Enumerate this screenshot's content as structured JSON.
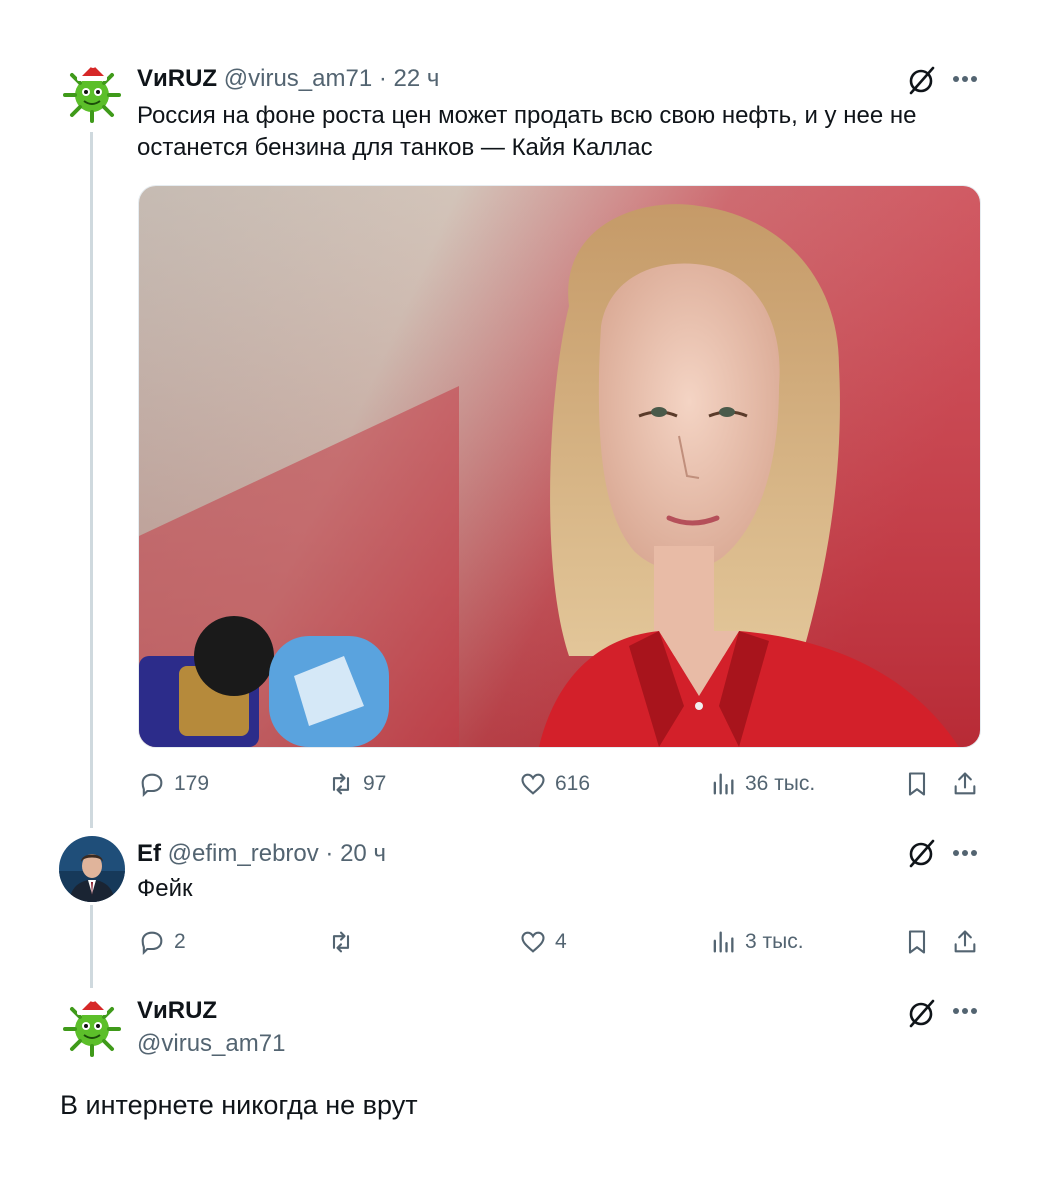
{
  "tweet1": {
    "name": "VиRUZ",
    "handle": "@virus_am71",
    "time": "· 22 ч",
    "text_line1": "Россия на фоне роста цен может продать всю свою нефть, и у нее не",
    "text_line2": "останется бензина для танков — Кайя Каллас",
    "replies": "179",
    "reposts": "97",
    "likes": "616",
    "views": "36 тыс."
  },
  "tweet2": {
    "name": "Ef",
    "handle": "@efim_rebrov",
    "time": "· 20 ч",
    "text": "Фейк",
    "replies": "2",
    "reposts": "",
    "likes": "4",
    "views": "3 тыс."
  },
  "tweet3": {
    "name": "VиRUZ",
    "handle": "@virus_am71",
    "text": "В интернете никогда не врут"
  },
  "colors": {
    "text": "#0f1419",
    "secondary": "#536471",
    "thread": "#cfd9de",
    "blazer": "#d3202a"
  },
  "icons": [
    "reply-icon",
    "repost-icon",
    "like-icon",
    "views-icon",
    "bookmark-icon",
    "share-icon",
    "grok-icon",
    "more-icon"
  ]
}
